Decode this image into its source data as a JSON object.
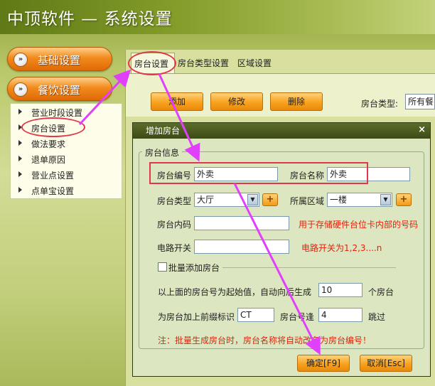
{
  "header": {
    "title": "中顶软件 — 系统设置"
  },
  "sidebar": {
    "main_items": [
      {
        "label": "基础设置",
        "icon": "double-chevron-right-icon"
      },
      {
        "label": "餐饮设置",
        "icon": "double-chevron-right-icon"
      }
    ],
    "sub_items": [
      {
        "label": "营业时段设置"
      },
      {
        "label": "房台设置"
      },
      {
        "label": "做法要求"
      },
      {
        "label": "退单原因"
      },
      {
        "label": "营业点设置"
      },
      {
        "label": "点单宝设置"
      }
    ]
  },
  "tabs": [
    {
      "label": "房台设置",
      "active": true
    },
    {
      "label": "房台类型设置",
      "active": false
    },
    {
      "label": "区域设置",
      "active": false
    }
  ],
  "toolbar": {
    "add_label": "添加",
    "edit_label": "修改",
    "delete_label": "删除",
    "type_filter_label": "房台类型:",
    "type_filter_value": "所有餐"
  },
  "dialog": {
    "title": "增加房台",
    "close_icon": "×",
    "group_label": "房台信息",
    "table_no": {
      "label": "房台编号",
      "value": "外卖"
    },
    "table_name": {
      "label": "房台名称",
      "value": "外卖"
    },
    "table_type": {
      "label": "房台类型",
      "value": "大厅"
    },
    "area": {
      "label": "所属区域",
      "value": "一楼"
    },
    "inner_code": {
      "label": "房台内码",
      "value": "",
      "note": "用于存储硬件台位卡内部的号码"
    },
    "circuit_switch": {
      "label": "电路开关",
      "value": "",
      "note": "电路开关为1,2,3....n"
    },
    "batch": {
      "label": "批量添加房台",
      "start_text": "以上面的房台号为起始值，自动向后生成",
      "count_value": "10",
      "count_unit": "个房台",
      "prefix_text": "为房台加上前缀标识",
      "prefix_value": "CT",
      "skip_text": "房台号逢",
      "skip_value": "4",
      "skip_unit": "跳过"
    },
    "warning": "注：批量生成房台时，房台名称将自动改名为房台编号！",
    "ok_label": "确定[F9]",
    "cancel_label": "取消[Esc]",
    "plus_label": "+",
    "dropdown_arrow": "▼"
  },
  "colors": {
    "accent_orange": "#f29a14",
    "annotation_red": "#e0384a",
    "annotation_arrow": "#e040fb",
    "note_red": "#e0240c"
  }
}
